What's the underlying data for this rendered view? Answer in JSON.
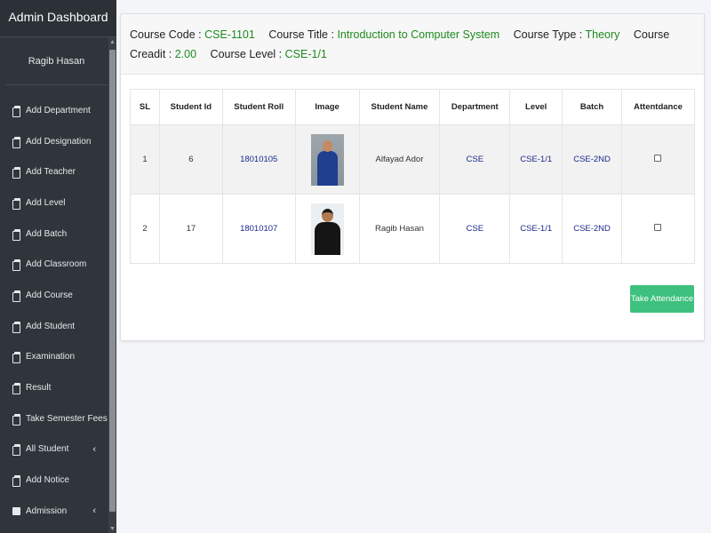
{
  "sidebar": {
    "title": "Admin Dashboard",
    "user": "Ragib Hasan",
    "items": [
      {
        "label": "Add Department"
      },
      {
        "label": "Add Designation"
      },
      {
        "label": "Add Teacher"
      },
      {
        "label": "Add Level"
      },
      {
        "label": "Add Batch"
      },
      {
        "label": "Add Classroom"
      },
      {
        "label": "Add Course"
      },
      {
        "label": "Add Student"
      },
      {
        "label": "Examination"
      },
      {
        "label": "Result"
      },
      {
        "label": "Take Semester Fees"
      },
      {
        "label": "All Student",
        "chevron": "‹"
      },
      {
        "label": "Add Notice"
      },
      {
        "label": "Admission",
        "chevron": "‹"
      }
    ]
  },
  "course": {
    "code_label": "Course Code : ",
    "code": "CSE-1101",
    "title_label": "Course Title : ",
    "title": "Introduction to Computer System",
    "type_label": "Course Type : ",
    "type": "Theory",
    "credit_label": "Course Creadit : ",
    "credit": "2.00",
    "level_label": "Course Level : ",
    "level": "CSE-1/1"
  },
  "table": {
    "headers": [
      "SL",
      "Student Id",
      "Student Roll",
      "Image",
      "Student Name",
      "Department",
      "Level",
      "Batch",
      "Attentdance"
    ],
    "rows": [
      {
        "sl": "1",
        "id": "6",
        "roll": "18010105",
        "name": "Alfayad Ador",
        "dept": "CSE",
        "level": "CSE-1/1",
        "batch": "CSE-2ND",
        "attendance": false
      },
      {
        "sl": "2",
        "id": "17",
        "roll": "18010107",
        "name": "Ragib Hasan",
        "dept": "CSE",
        "level": "CSE-1/1",
        "batch": "CSE-2ND",
        "attendance": false
      }
    ]
  },
  "actions": {
    "take_attendance": "Take Attendance"
  },
  "colors": {
    "sidebar_bg": "#2f353b",
    "value_green": "#1f8a1f",
    "link_blue": "#1a2a8a",
    "button_green": "#3ec07e"
  }
}
